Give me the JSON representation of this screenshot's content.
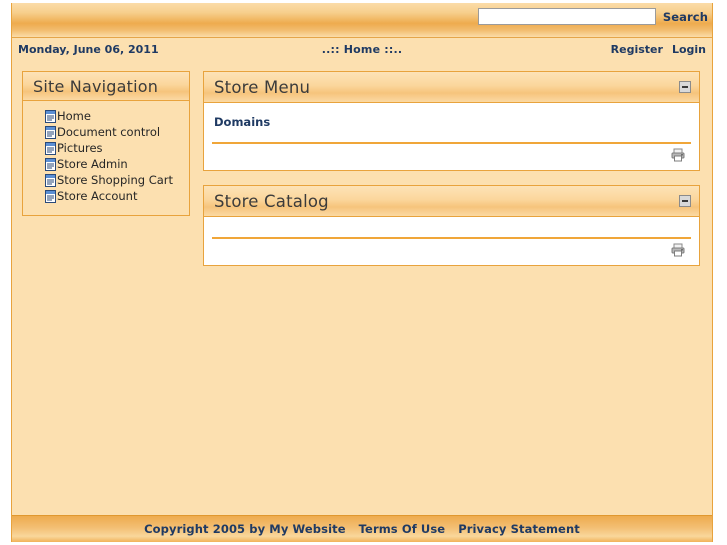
{
  "header": {
    "search": {
      "value": "",
      "placeholder": "",
      "button_label": "Search",
      "icon": "search-icon"
    },
    "date_label": "Monday, June 06, 2011",
    "breadcrumb": "..:: Home ::..",
    "register_label": "Register",
    "login_label": "Login"
  },
  "sidebar": {
    "title": "Site Navigation",
    "collapse_icon": "minus-icon",
    "items": [
      {
        "label": "Home",
        "icon": "document-icon"
      },
      {
        "label": "Document control",
        "icon": "document-icon"
      },
      {
        "label": "Pictures",
        "icon": "document-icon"
      },
      {
        "label": "Store Admin",
        "icon": "document-icon"
      },
      {
        "label": "Store Shopping Cart",
        "icon": "document-icon"
      },
      {
        "label": "Store Account",
        "icon": "document-icon"
      }
    ]
  },
  "panels": {
    "store_menu": {
      "title": "Store Menu",
      "collapse_icon": "minus-icon",
      "links": [
        {
          "label": "Domains"
        }
      ],
      "print_icon": "printer-icon"
    },
    "store_catalog": {
      "title": "Store Catalog",
      "collapse_icon": "minus-icon",
      "links": [],
      "print_icon": "printer-icon"
    }
  },
  "footer": {
    "copyright": "Copyright 2005 by My Website",
    "terms_label": "Terms Of Use",
    "privacy_label": "Privacy Statement"
  },
  "colors": {
    "accent": "#e8a33d",
    "page_bg": "#fce0b0",
    "link": "#1f3a63",
    "rule": "#f0a639"
  }
}
